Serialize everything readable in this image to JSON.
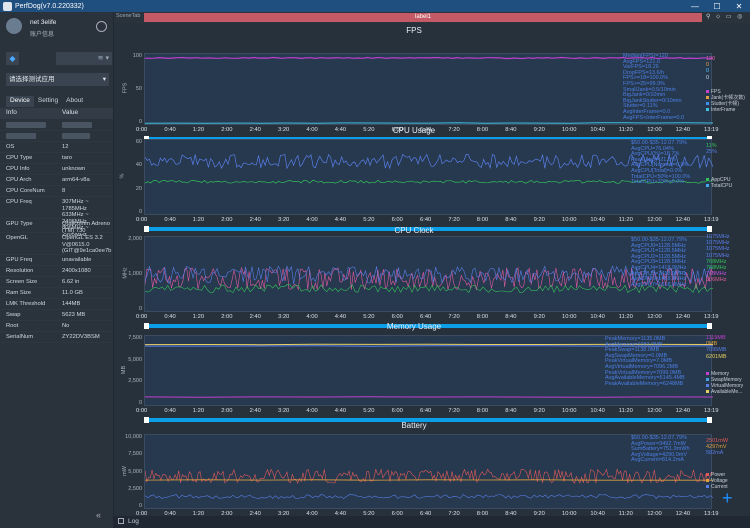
{
  "window": {
    "title": "PerfDog(v7.0.220332)",
    "minimize": "—",
    "maximize": "☐",
    "close": "✕"
  },
  "user": {
    "name": "net 3elife",
    "info": "账户信息"
  },
  "device_select": {
    "signal_icon": "wifi-icon"
  },
  "app_select": {
    "label": "请选择测试应用"
  },
  "tabs": [
    "Device",
    "Setting",
    "About"
  ],
  "table": {
    "col_info": "Info",
    "col_value": "Value",
    "rows": [
      {
        "k": "OS",
        "v": "12"
      },
      {
        "k": "CPU Type",
        "v": "taro"
      },
      {
        "k": "CPU Info",
        "v": "unknown"
      },
      {
        "k": "CPU Arch",
        "v": "arm64-v8a"
      },
      {
        "k": "CPU CoreNum",
        "v": "8"
      },
      {
        "k": "CPU Freq",
        "v": "307MHz ~ 1785MHz\n633MHz ~ 2496MHz\n806MHz ~ 2995MHz"
      },
      {
        "k": "GPU Type",
        "v": "Qualcomm Adreno (TM) 730"
      },
      {
        "k": "OpenGL",
        "v": "OpenGL ES 3.2 V@0615.0 (GIT@9e1ca0ee7b"
      },
      {
        "k": "GPU Freq",
        "v": "unavailable"
      },
      {
        "k": "Resolution",
        "v": "2400x1080"
      },
      {
        "k": "Screen Size",
        "v": "6.62 in"
      },
      {
        "k": "Ram Size",
        "v": "11.0 GB"
      },
      {
        "k": "LMK Threshold",
        "v": "144MB"
      },
      {
        "k": "Swap",
        "v": "5623 MB"
      },
      {
        "k": "Root",
        "v": "No"
      },
      {
        "k": "SerialNum",
        "v": "ZY22DV3BSM"
      }
    ]
  },
  "scene": {
    "tab": "SceneTab",
    "label": "label1"
  },
  "x_ticks": [
    "0:00",
    "0:40",
    "1:20",
    "2:00",
    "2:40",
    "3:20",
    "4:00",
    "4:40",
    "5:20",
    "6:00",
    "6:40",
    "7:20",
    "8:00",
    "8:40",
    "9:20",
    "10:00",
    "10:40",
    "11:20",
    "12:00",
    "12:40",
    "13:19"
  ],
  "charts": [
    {
      "title": "FPS",
      "ylabel": "FPS",
      "yticks": [
        "100",
        "50",
        "0"
      ],
      "stats": [
        "Median(FPS)=120",
        "AvgFPS=121.0",
        "VarFPS=18.26",
        "DropFPS=13.6/h",
        "FPS>=18=100.0%",
        "FPS>=25=99.9%",
        "SmallJank=0.5/10min",
        "BigJank=0/10min",
        "BigJankStutter=0/10min",
        "Stutter=0.11%",
        "AvgInterFrame=0.0",
        "AvgFPS<InterFrame=0.0"
      ],
      "right_values": [
        {
          "t": "120",
          "c": "#e05cb0"
        },
        {
          "t": "0",
          "c": "#e8a048"
        },
        {
          "t": "0",
          "c": "#59c3f5"
        },
        {
          "t": "0",
          "c": "#d0d8e0"
        }
      ],
      "legend": [
        {
          "t": "FPS",
          "c": "#c040d0"
        },
        {
          "t": "Jank(卡顿次数)",
          "c": "#e0a040"
        },
        {
          "t": "Stutter(卡顿)",
          "c": "#4090f0"
        },
        {
          "t": "InterFrame",
          "c": "#40c0e0"
        }
      ]
    },
    {
      "title": "CPU Usage",
      "ylabel": "%",
      "yticks": [
        "60",
        "40",
        "20",
        "0"
      ],
      "stats": [
        "$50.00-$35-12.07.79%",
        "AvgCPU=76.04%",
        "AvgCPU(%)=18.7%",
        "Peak(App)=21.8%",
        "AvgCPU[Normal]=0.0%",
        "AvgCPU[Total]=0.0%",
        "TotalCPU<50%=100.0%",
        "TotalCPU>70%=0.0%"
      ],
      "right_values": [
        {
          "t": "11%",
          "c": "#35c05a"
        },
        {
          "t": "25%",
          "c": "#5a7ee8"
        }
      ],
      "legend": [
        {
          "t": "AppCPU",
          "c": "#35c05a"
        },
        {
          "t": "TotalCPU",
          "c": "#40a8f0"
        }
      ]
    },
    {
      "title": "CPU Clock",
      "ylabel": "MHz",
      "yticks": [
        "2,000",
        "1,000",
        "0"
      ],
      "stats": [
        "$50.00-$35-12.07.79%",
        "AvgCPU0=1128.5MHz",
        "AvgCPU1=1128.5MHz",
        "AvgCPU2=1128.5MHz",
        "AvgCPU3=1128.5MHz",
        "AvgCPU4=1418.9MHz",
        "AvgCPU5=1418.9MHz",
        "AvgCPU6=1418.9MHz",
        "AvgCPU7=1618.8MHz"
      ],
      "right_values": [
        {
          "t": "1075MHz",
          "c": "#5a7ee8"
        },
        {
          "t": "1075MHz",
          "c": "#5a7ee8"
        },
        {
          "t": "1075MHz",
          "c": "#5a7ee8"
        },
        {
          "t": "1075MHz",
          "c": "#5a7ee8"
        },
        {
          "t": "768MHz",
          "c": "#35c05a"
        },
        {
          "t": "768MHz",
          "c": "#35c05a"
        },
        {
          "t": "768MHz",
          "c": "#c050e0"
        },
        {
          "t": "806MHz",
          "c": "#e05aa0"
        }
      ],
      "legend": []
    },
    {
      "title": "Memory Usage",
      "ylabel": "MB",
      "yticks": [
        "7,500",
        "5,000",
        "2,500",
        "0"
      ],
      "stats": [
        "PeakMemory=1135.0MB",
        "AvgMemory=1081.0MB",
        "PeakSwap=1138.0MB",
        "AvgSwapMemory=0.0MB",
        "PeakVirtualMemory=7.0MB",
        "AvgVirtualMemory=7096.2MB",
        "PeakVirtualMemory=7099.0MB",
        "AvgAvailableMemory=5145.4MB",
        "PeakAvailableMemory=6248MB"
      ],
      "right_values": [
        {
          "t": "1119MB",
          "c": "#c040d0"
        },
        {
          "t": "0MB",
          "c": "#e0a040"
        },
        {
          "t": "7095MB",
          "c": "#5a7ee8"
        },
        {
          "t": "6201MB",
          "c": "#e8d060"
        }
      ],
      "legend": [
        {
          "t": "Memory",
          "c": "#c040d0"
        },
        {
          "t": "SwapMemory",
          "c": "#40a0e0"
        },
        {
          "t": "VirtualMemory",
          "c": "#5a7ee8"
        },
        {
          "t": "AvailableMe...",
          "c": "#e8d060"
        }
      ]
    },
    {
      "title": "Battery",
      "ylabel": "mW",
      "yticks": [
        "10,000",
        "7,500",
        "5,000",
        "2,500",
        "0"
      ],
      "stats": [
        "$50.00-$35-12.07.79%",
        "AvgPower=3492.7mW",
        "SumBattery=751.9mWh",
        "AvgVoltage=4290.0mV",
        "AvgCurrent=814.2mA"
      ],
      "right_values": [
        {
          "t": "2501mW",
          "c": "#e05a5a"
        },
        {
          "t": "4297mV",
          "c": "#e0a040"
        },
        {
          "t": "582mA",
          "c": "#5a7ee8"
        }
      ],
      "legend": [
        {
          "t": "Power",
          "c": "#e05a5a"
        },
        {
          "t": "Voltage",
          "c": "#e0a040"
        },
        {
          "t": "Current",
          "c": "#5a7ee8"
        }
      ]
    }
  ],
  "bottom": {
    "log_label": "Log"
  }
}
